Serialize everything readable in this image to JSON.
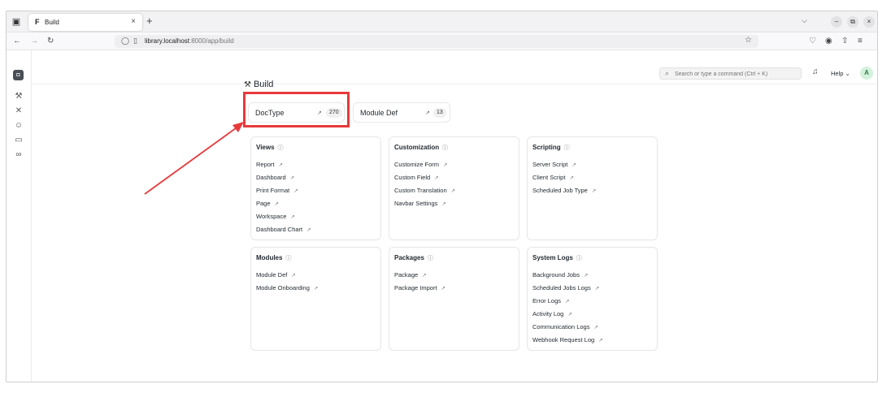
{
  "browser": {
    "tab_title": "Build",
    "tab_favicon": "F",
    "url_host": "library.localhost",
    "url_rest": ":8000/app/build"
  },
  "header": {
    "search_placeholder": "Search or type a command (Ctrl + K)",
    "help_label": "Help",
    "avatar_initial": "A"
  },
  "page": {
    "title": "Build"
  },
  "shortcuts": [
    {
      "label": "DocType",
      "count": "270"
    },
    {
      "label": "Module Def",
      "count": "13"
    }
  ],
  "cards": [
    {
      "title": "Views",
      "links": [
        "Report",
        "Dashboard",
        "Print Format",
        "Page",
        "Workspace",
        "Dashboard Chart"
      ]
    },
    {
      "title": "Customization",
      "links": [
        "Customize Form",
        "Custom Field",
        "Custom Translation",
        "Navbar Settings"
      ]
    },
    {
      "title": "Scripting",
      "links": [
        "Server Script",
        "Client Script",
        "Scheduled Job Type"
      ]
    },
    {
      "title": "Modules",
      "links": [
        "Module Def",
        "Module Onboarding"
      ]
    },
    {
      "title": "Packages",
      "links": [
        "Package",
        "Package Import"
      ]
    },
    {
      "title": "System Logs",
      "links": [
        "Background Jobs",
        "Scheduled Jobs Logs",
        "Error Logs",
        "Activity Log",
        "Communication Logs",
        "Webhook Request Log"
      ]
    }
  ],
  "icons": {
    "link_arrow": "↗",
    "info": "ⓘ"
  },
  "colors": {
    "annotation": "#e8393b",
    "avatar_bg": "#d4f1dd"
  }
}
